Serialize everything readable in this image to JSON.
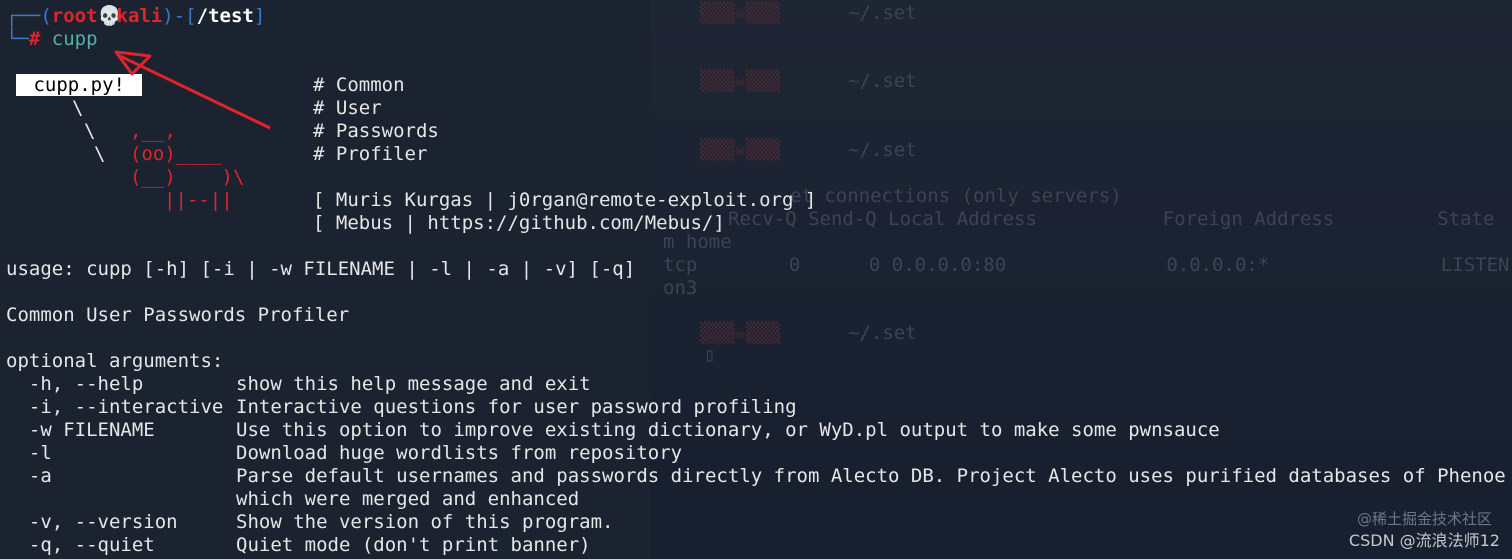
{
  "prompt": {
    "user": "root",
    "host": "kali",
    "cwd": "/test",
    "command": "cupp"
  },
  "banner": {
    "bubble": "cupp.py!",
    "menu": [
      "# Common",
      "# User",
      "# Passwords",
      "# Profiler"
    ],
    "credits": [
      "[ Muris Kurgas | j0rgan@remote-exploit.org ]",
      "[ Mebus | https://github.com/Mebus/]"
    ],
    "art": [
      "\\",
      "\\",
      "\\",
      ",__,",
      "(oo)____",
      "(__)    )\\",
      "||--||"
    ]
  },
  "usage": "usage: cupp [-h] [-i | -w FILENAME | -l | -a | -v] [-q]",
  "description": "Common User Passwords Profiler",
  "section": "optional arguments:",
  "args": [
    {
      "flag": "  -h, --help",
      "desc": "show this help message and exit"
    },
    {
      "flag": "  -i, --interactive",
      "desc": "Interactive questions for user password profiling"
    },
    {
      "flag": "  -w FILENAME",
      "desc": "Use this option to improve existing dictionary, or WyD.pl output to make some pwnsauce"
    },
    {
      "flag": "  -l",
      "desc": "Download huge wordlists from repository"
    },
    {
      "flag": "  -a",
      "desc": "Parse default usernames and passwords directly from Alecto DB. Project Alecto uses purified databases of Phenoelit a"
    },
    {
      "flag": "",
      "desc": "which were merged and enhanced"
    },
    {
      "flag": "  -v, --version",
      "desc": "Show the version of this program."
    },
    {
      "flag": "  -q, --quiet",
      "desc": "Quiet mode (don't print banner)"
    }
  ],
  "background_ghost": {
    "prompt_suffix": "~/.set",
    "net_header": "et connections (only servers)",
    "columns": "Recv-Q Send-Q Local Address           Foreign Address         State",
    "row_prefix": "m home",
    "row": "tcp        0      0 0.0.0.0:80              0.0.0.0:*               LISTEN",
    "row_suffix": "on3"
  },
  "watermark": {
    "primary": "CSDN @流浪法师12",
    "secondary": "@稀土掘金技术社区"
  },
  "colors": {
    "background": "#1b2230",
    "prompt_blue": "#3b78c9",
    "prompt_red": "#e0242b",
    "command_teal": "#4fb3a6",
    "arrow_red": "#e0242b"
  }
}
